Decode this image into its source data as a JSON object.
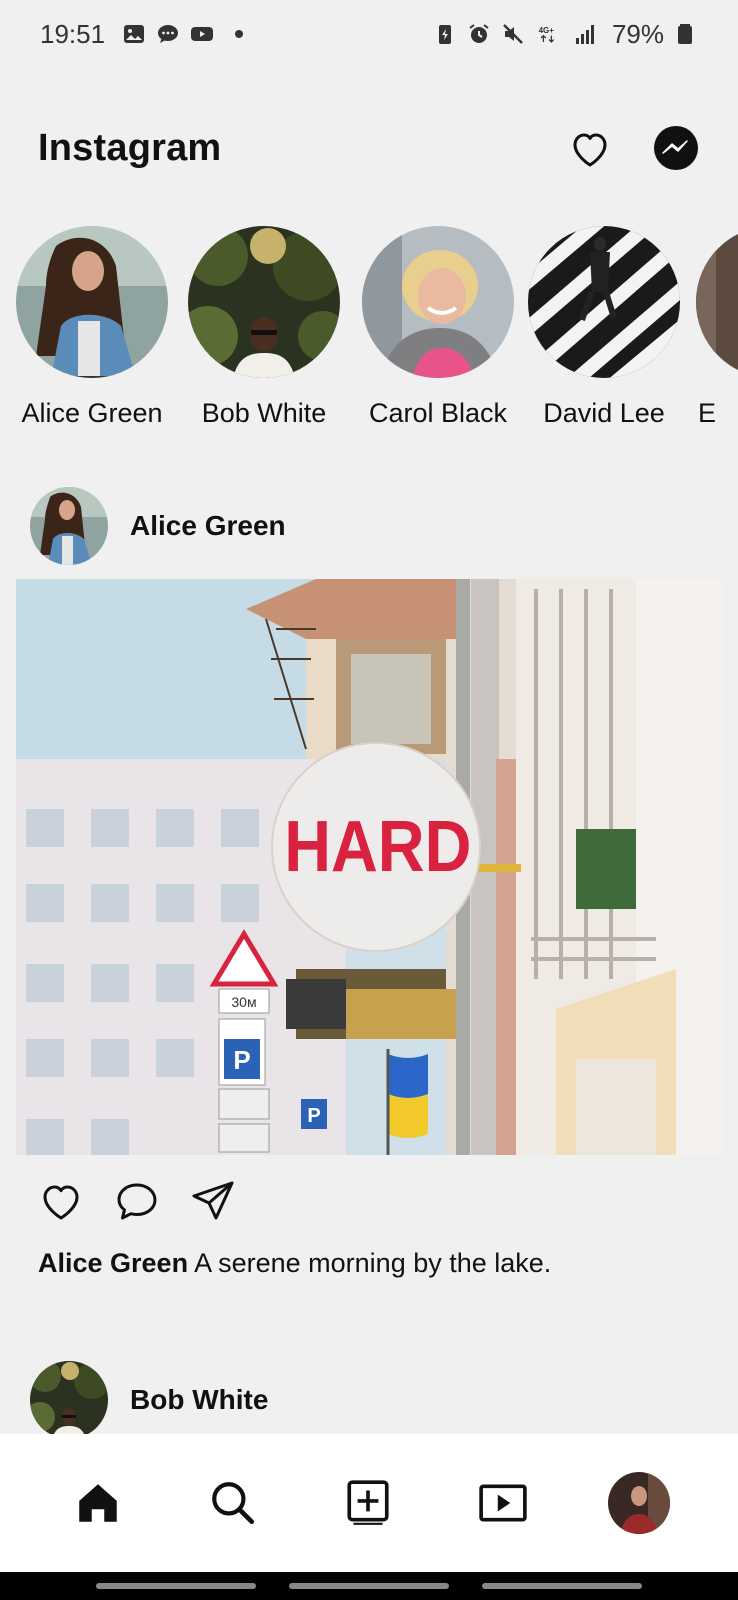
{
  "status_bar": {
    "time": "19:51",
    "battery": "79%",
    "network": "4G+",
    "left_icons": [
      "gallery-icon",
      "chat-bubble-icon",
      "youtube-icon"
    ],
    "right_icons": [
      "battery-saver-icon",
      "alarm-icon",
      "mute-icon",
      "network-icon",
      "signal-icon",
      "battery-icon"
    ]
  },
  "header": {
    "title": "Instagram",
    "actions": [
      "heart-icon",
      "messenger-icon"
    ]
  },
  "stories": [
    {
      "name": "Alice Green"
    },
    {
      "name": "Bob White"
    },
    {
      "name": "Carol Black"
    },
    {
      "name": "David Lee"
    },
    {
      "name": "E"
    }
  ],
  "posts": [
    {
      "user": "Alice Green",
      "image_sign_text": "HARD",
      "caption_user": "Alice Green",
      "caption_text": " A serene morning by the lake."
    },
    {
      "user": "Bob White"
    }
  ],
  "bottom_nav": [
    "home-icon",
    "search-icon",
    "new-post-icon",
    "reels-icon",
    "profile-avatar"
  ],
  "colors": {
    "background": "#f0f0f0",
    "nav_background": "#ffffff",
    "sign_red": "#d8223f"
  }
}
